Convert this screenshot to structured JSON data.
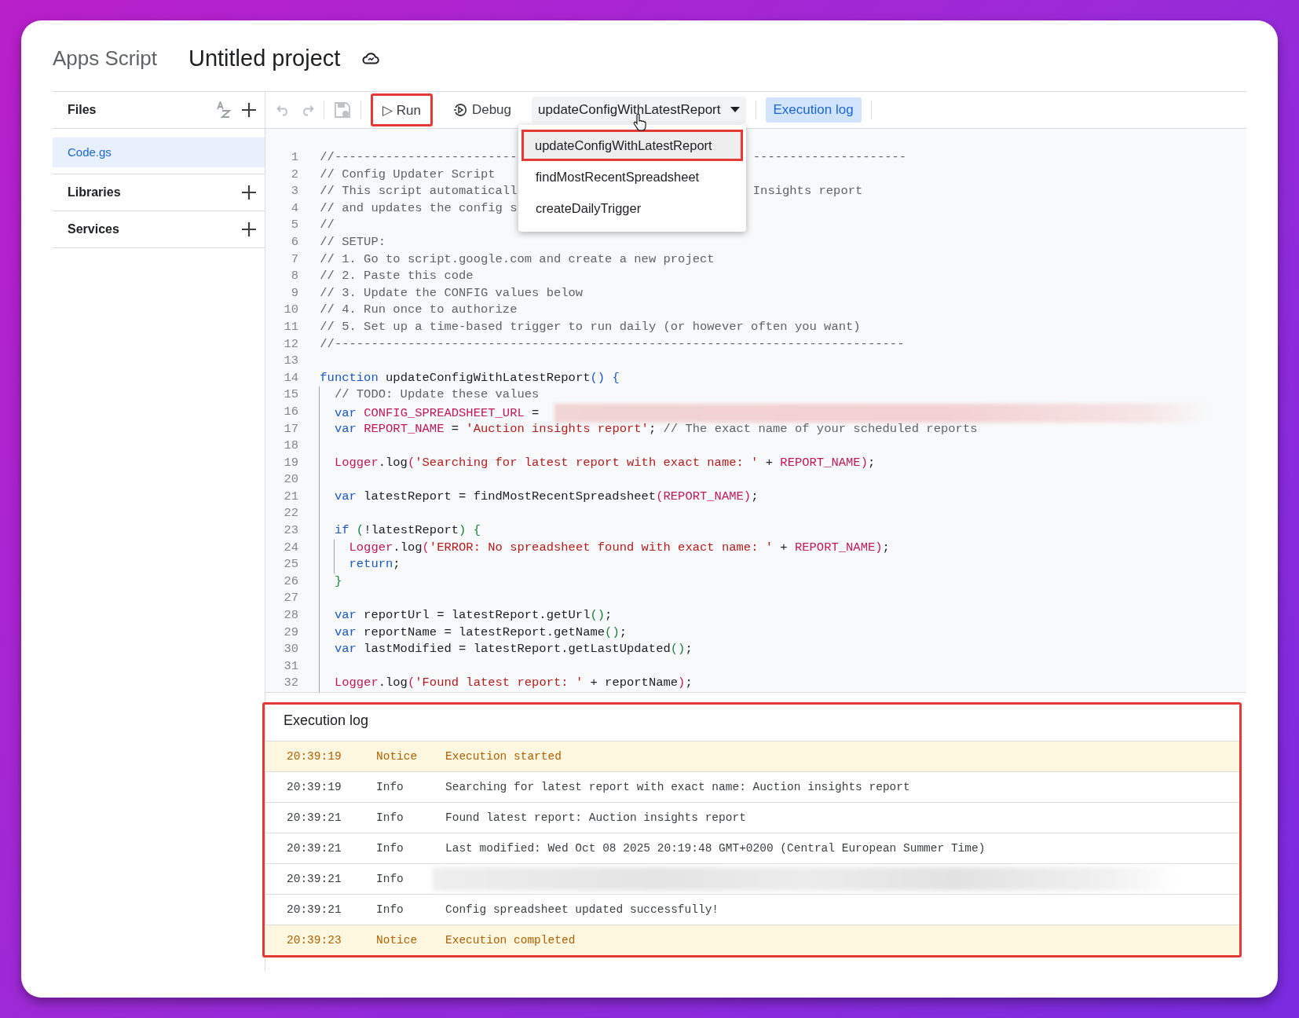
{
  "header": {
    "product": "Apps Script",
    "project_title": "Untitled project"
  },
  "sidebar": {
    "files_label": "Files",
    "files": [
      {
        "name": "Code.gs",
        "selected": true
      }
    ],
    "sections": [
      {
        "label": "Libraries"
      },
      {
        "label": "Services"
      }
    ]
  },
  "toolbar": {
    "undo_disabled": true,
    "redo_disabled": true,
    "save_disabled": true,
    "run": {
      "label": "▷ Run",
      "highlighted": true
    },
    "debug": {
      "label": "Debug"
    },
    "function_select": {
      "value": "updateConfigWithLatestReport",
      "expanded": true
    },
    "execution_log_toggle": {
      "label": "Execution log",
      "on": true
    }
  },
  "function_menu": [
    {
      "label": "updateConfigWithLatestReport",
      "selected": true,
      "highlighted": true
    },
    {
      "label": "findMostRecentSpreadsheet",
      "selected": false,
      "highlighted": false
    },
    {
      "label": "createDailyTrigger",
      "selected": false,
      "highlighted": false
    }
  ],
  "code_lines": [
    {
      "num": "1",
      "tokens": [
        {
          "kind": "comment",
          "text": "//-------------------------"
        }
      ],
      "tail": "---------------------"
    },
    {
      "num": "2",
      "tokens": [
        {
          "kind": "comment",
          "text": "// Config Updater Script"
        }
      ]
    },
    {
      "num": "3",
      "tokens": [
        {
          "kind": "comment",
          "text": "// This script automaticall"
        }
      ],
      "tail": "Insights report"
    },
    {
      "num": "4",
      "tokens": [
        {
          "kind": "comment",
          "text": "// and updates the config s"
        }
      ]
    },
    {
      "num": "5",
      "tokens": [
        {
          "kind": "comment",
          "text": "//"
        }
      ]
    },
    {
      "num": "6",
      "tokens": [
        {
          "kind": "comment",
          "text": "// SETUP:"
        }
      ]
    },
    {
      "num": "7",
      "tokens": [
        {
          "kind": "comment",
          "text": "// 1. Go to script.google.com and create a new project"
        }
      ]
    },
    {
      "num": "8",
      "tokens": [
        {
          "kind": "comment",
          "text": "// 2. Paste this code"
        }
      ]
    },
    {
      "num": "9",
      "tokens": [
        {
          "kind": "comment",
          "text": "// 3. Update the CONFIG values below"
        }
      ]
    },
    {
      "num": "10",
      "tokens": [
        {
          "kind": "comment",
          "text": "// 4. Run once to authorize"
        }
      ]
    },
    {
      "num": "11",
      "tokens": [
        {
          "kind": "comment",
          "text": "// 5. Set up a time-based trigger to run daily (or however often you want)"
        }
      ]
    },
    {
      "num": "12",
      "tokens": [
        {
          "kind": "comment",
          "text": "//------------------------------------------------------------------------------"
        }
      ]
    },
    {
      "num": "13"
    },
    {
      "num": "14",
      "tokens": [
        {
          "kind": "keyword",
          "text": "function"
        },
        {
          "kind": "plain",
          "text": " updateConfigWithLatestReport"
        },
        {
          "kind": "bracket_blue",
          "text": "()"
        },
        {
          "kind": "bracket_blue",
          "text": " {"
        }
      ],
      "children": [
        {
          "num": "15",
          "tokens": [
            {
              "kind": "comment",
              "text": "// TODO: Update these values"
            }
          ]
        },
        {
          "num": "16",
          "tokens": [
            {
              "kind": "keyword",
              "text": "var "
            },
            {
              "kind": "constant",
              "text": "CONFIG_SPREADSHEET_URL"
            },
            {
              "kind": "plain",
              "text": " ="
            },
            {
              "kind": "redacted"
            }
          ]
        },
        {
          "num": "17",
          "tokens": [
            {
              "kind": "keyword",
              "text": "var "
            },
            {
              "kind": "constant",
              "text": "REPORT_NAME"
            },
            {
              "kind": "plain",
              "text": " = "
            },
            {
              "kind": "string",
              "text": "'Auction insights report'"
            },
            {
              "kind": "plain",
              "text": ";"
            },
            {
              "kind": "comment",
              "text": " // The exact name of your scheduled reports"
            }
          ]
        },
        {
          "num": "18"
        },
        {
          "num": "19",
          "tokens": [
            {
              "kind": "constant",
              "text": "Logger"
            },
            {
              "kind": "plain",
              "text": ".log"
            },
            {
              "kind": "bracket_magenta",
              "text": "("
            },
            {
              "kind": "string",
              "text": "'Searching for latest report with exact name: '"
            },
            {
              "kind": "plain",
              "text": " + "
            },
            {
              "kind": "constant",
              "text": "REPORT_NAME"
            },
            {
              "kind": "bracket_magenta",
              "text": ")"
            },
            {
              "kind": "plain",
              "text": ";"
            }
          ]
        },
        {
          "num": "20"
        },
        {
          "num": "21",
          "tokens": [
            {
              "kind": "keyword",
              "text": "var"
            },
            {
              "kind": "plain",
              "text": " latestReport = findMostRecentSpreadsheet"
            },
            {
              "kind": "bracket_magenta",
              "text": "("
            },
            {
              "kind": "constant",
              "text": "REPORT_NAME"
            },
            {
              "kind": "bracket_magenta",
              "text": ")"
            },
            {
              "kind": "plain",
              "text": ";"
            }
          ]
        },
        {
          "num": "22"
        },
        {
          "num": "23",
          "tokens": [
            {
              "kind": "keyword",
              "text": "if "
            },
            {
              "kind": "bracket_green",
              "text": "("
            },
            {
              "kind": "plain",
              "text": "!latestReport"
            },
            {
              "kind": "bracket_green",
              "text": ")"
            },
            {
              "kind": "bracket_green",
              "text": " {"
            }
          ],
          "children": [
            {
              "num": "24",
              "tokens": [
                {
                  "kind": "constant",
                  "text": "Logger"
                },
                {
                  "kind": "plain",
                  "text": ".log"
                },
                {
                  "kind": "bracket_magenta",
                  "text": "("
                },
                {
                  "kind": "string",
                  "text": "'ERROR: No spreadsheet found with exact name: '"
                },
                {
                  "kind": "plain",
                  "text": " + "
                },
                {
                  "kind": "constant",
                  "text": "REPORT_NAME"
                },
                {
                  "kind": "bracket_magenta",
                  "text": ")"
                },
                {
                  "kind": "plain",
                  "text": ";"
                }
              ]
            },
            {
              "num": "25",
              "tokens": [
                {
                  "kind": "keyword",
                  "text": "return"
                },
                {
                  "kind": "plain",
                  "text": ";"
                }
              ]
            }
          ]
        },
        {
          "num": "26",
          "tokens": [
            {
              "kind": "bracket_green",
              "text": "}"
            }
          ]
        },
        {
          "num": "27"
        },
        {
          "num": "28",
          "tokens": [
            {
              "kind": "keyword",
              "text": "var"
            },
            {
              "kind": "plain",
              "text": " reportUrl = latestReport.getUrl"
            },
            {
              "kind": "bracket_green",
              "text": "()"
            },
            {
              "kind": "plain",
              "text": ";"
            }
          ]
        },
        {
          "num": "29",
          "tokens": [
            {
              "kind": "keyword",
              "text": "var"
            },
            {
              "kind": "plain",
              "text": " reportName = latestReport.getName"
            },
            {
              "kind": "bracket_green",
              "text": "()"
            },
            {
              "kind": "plain",
              "text": ";"
            }
          ]
        },
        {
          "num": "30",
          "tokens": [
            {
              "kind": "keyword",
              "text": "var"
            },
            {
              "kind": "plain",
              "text": " lastModified = latestReport.getLastUpdated"
            },
            {
              "kind": "bracket_green",
              "text": "()"
            },
            {
              "kind": "plain",
              "text": ";"
            }
          ]
        },
        {
          "num": "31"
        },
        {
          "num": "32",
          "tokens": [
            {
              "kind": "constant",
              "text": "Logger"
            },
            {
              "kind": "plain",
              "text": ".log"
            },
            {
              "kind": "bracket_magenta",
              "text": "("
            },
            {
              "kind": "string",
              "text": "'Found latest report: '"
            },
            {
              "kind": "plain",
              "text": " + reportName"
            },
            {
              "kind": "bracket_magenta",
              "text": ")"
            },
            {
              "kind": "plain",
              "text": ";"
            }
          ]
        }
      ]
    }
  ],
  "execution_log": {
    "title": "Execution log",
    "highlighted": true,
    "rows": [
      {
        "time": "20:39:19",
        "level": "Notice",
        "kind": "notice",
        "message": "Execution started"
      },
      {
        "time": "20:39:19",
        "level": "Info",
        "kind": "info",
        "message": "Searching for latest report with exact name: Auction insights report"
      },
      {
        "time": "20:39:21",
        "level": "Info",
        "kind": "info",
        "message": "Found latest report: Auction insights report"
      },
      {
        "time": "20:39:21",
        "level": "Info",
        "kind": "info",
        "message": "Last modified: Wed Oct 08 2025 20:19:48 GMT+0200 (Central European Summer Time)"
      },
      {
        "time": "20:39:21",
        "level": "Info",
        "kind": "info",
        "redacted": true
      },
      {
        "time": "20:39:21",
        "level": "Info",
        "kind": "info",
        "message": "Config spreadsheet updated successfully!"
      },
      {
        "time": "20:39:23",
        "level": "Notice",
        "kind": "notice",
        "message": "Execution completed"
      }
    ]
  }
}
